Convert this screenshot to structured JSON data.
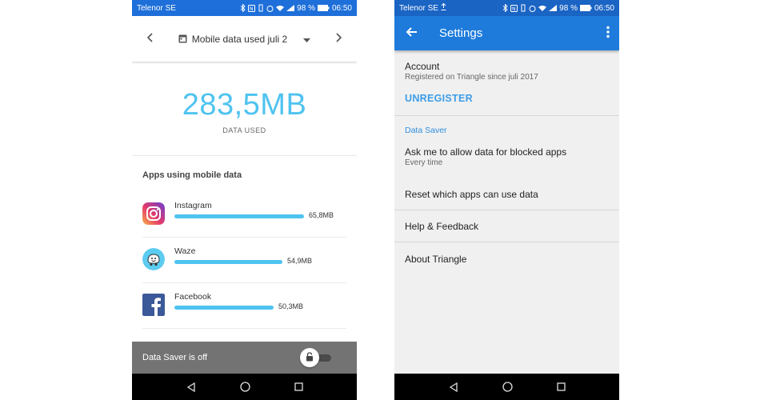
{
  "left": {
    "status": {
      "carrier": "Telenor SE",
      "battery": "98 %",
      "time": "06:50"
    },
    "month_selector": {
      "label": "Mobile data used juli 2"
    },
    "usage": {
      "amount": "283,5MB",
      "caption": "DATA USED"
    },
    "apps_heading": "Apps using mobile data",
    "apps": [
      {
        "name": "Instagram",
        "size": "65,8MB",
        "share": 1.0
      },
      {
        "name": "Waze",
        "size": "54,9MB",
        "share": 0.834
      },
      {
        "name": "Facebook",
        "size": "50,3MB",
        "share": 0.764
      }
    ],
    "data_saver": {
      "label": "Data Saver is off",
      "enabled": false
    }
  },
  "right": {
    "status": {
      "carrier": "Telenor SE",
      "battery": "98 %",
      "time": "06:50"
    },
    "appbar": {
      "title": "Settings"
    },
    "account": {
      "title": "Account",
      "subtitle": "Registered on Triangle since juli 2017",
      "action": "UNREGISTER"
    },
    "data_saver": {
      "header": "Data Saver",
      "ask_title": "Ask me to allow data for blocked apps",
      "ask_sub": "Every time",
      "reset": "Reset which apps can use data"
    },
    "help": "Help & Feedback",
    "about": "About Triangle"
  },
  "colors": {
    "accent": "#4fc3f0",
    "primary": "#1e7bdc",
    "link": "#3d9de8"
  }
}
